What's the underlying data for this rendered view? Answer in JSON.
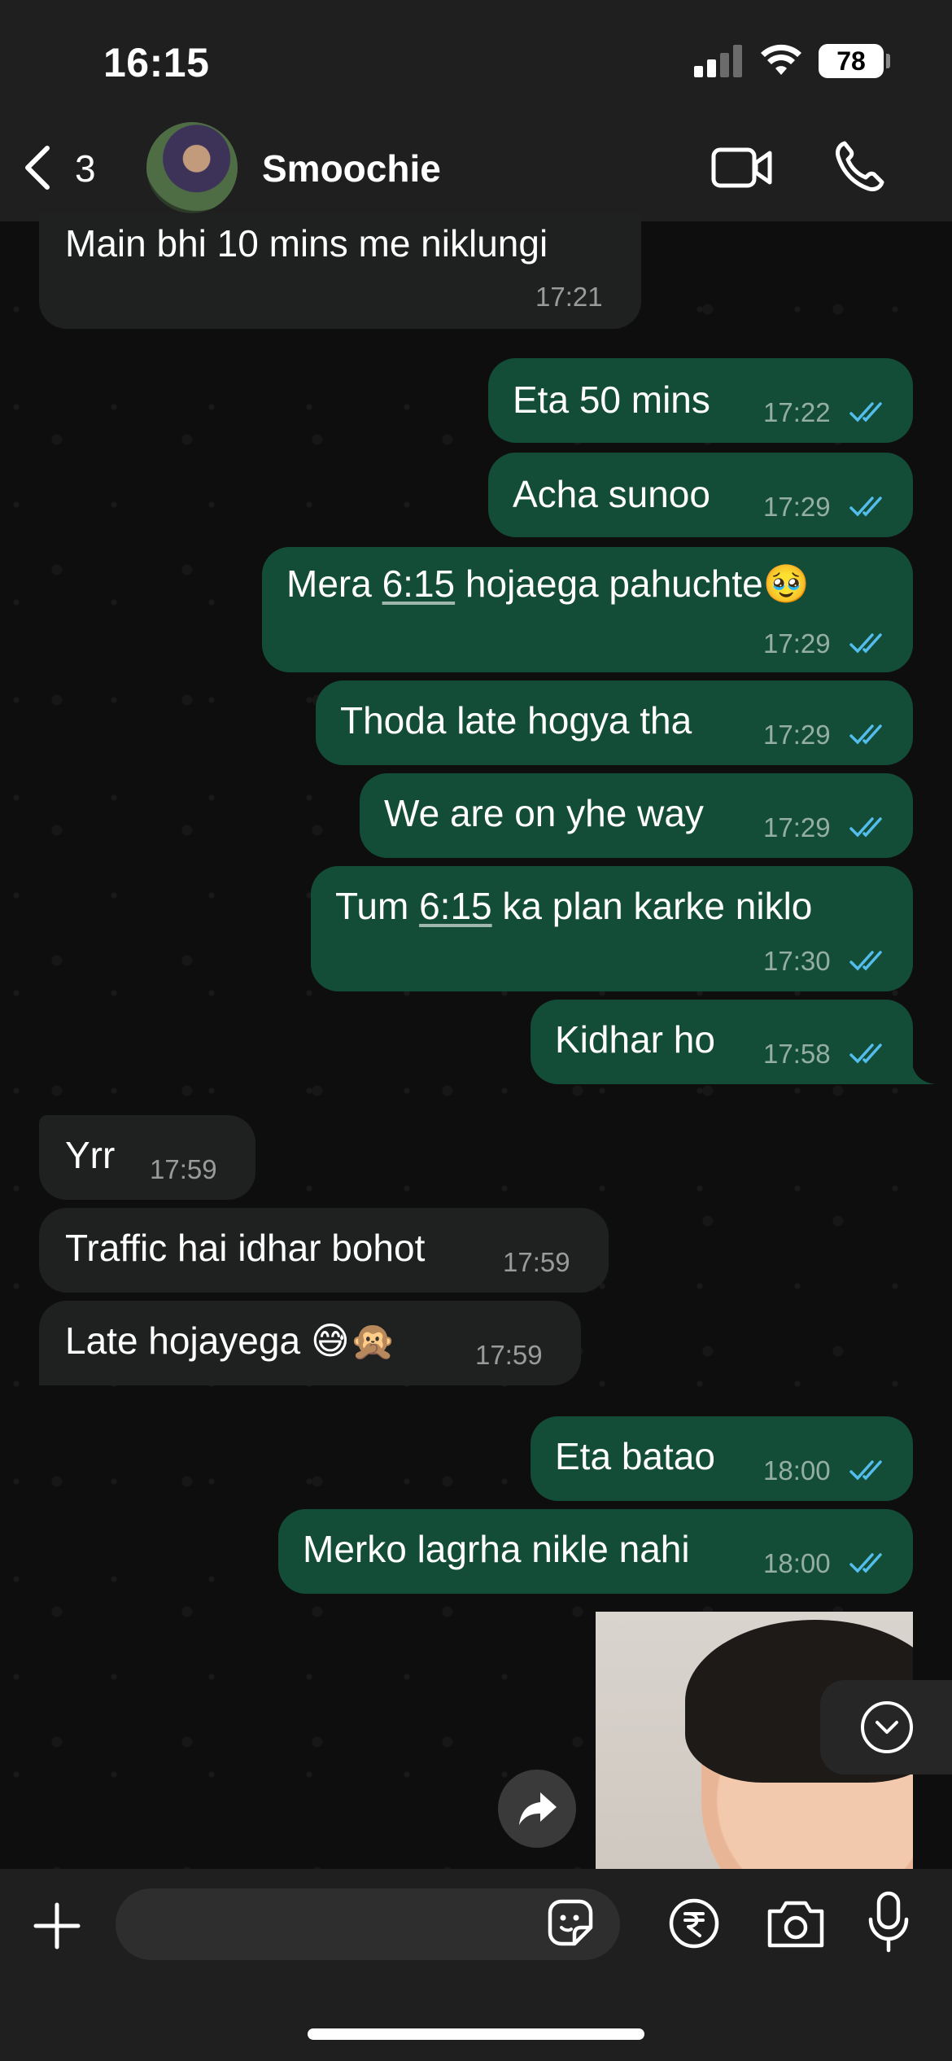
{
  "status_bar": {
    "time": "16:15",
    "battery": "78"
  },
  "header": {
    "back_count": "3",
    "contact_name": "Smoochie"
  },
  "messages": [
    {
      "text": "Main  bhi 10 mins me niklungi",
      "time": "17:21"
    },
    {
      "text": "Eta 50 mins",
      "time": "17:22"
    },
    {
      "text": "Acha sunoo",
      "time": "17:29"
    },
    {
      "text_a": "Mera ",
      "text_link": "6:15",
      "text_b": " hojaega pahuchte",
      "emoji": "🥹",
      "time": "17:29"
    },
    {
      "text": "Thoda late hogya tha",
      "time": "17:29"
    },
    {
      "text": "We are on yhe way",
      "time": "17:29"
    },
    {
      "text_a": "Tum ",
      "text_link": "6:15",
      "text_b": " ka plan karke niklo",
      "time": "17:30"
    },
    {
      "text": "Kidhar ho",
      "time": "17:58"
    },
    {
      "text": "Yrr",
      "time": "17:59"
    },
    {
      "text": "Traffic hai idhar bohot",
      "time": "17:59"
    },
    {
      "text": "Late hojayega ",
      "emoji": "😅🙊",
      "time": "17:59"
    },
    {
      "text": "Eta batao",
      "time": "18:00"
    },
    {
      "text": "Merko lagrha nikle nahi",
      "time": "18:00"
    }
  ],
  "composer": {
    "placeholder": ""
  },
  "colors": {
    "incoming": "#1f2121",
    "outgoing": "#134d37",
    "read_ticks": "#53bdeb"
  },
  "icons": [
    "back-chevron-icon",
    "video-call-icon",
    "phone-icon",
    "plus-icon",
    "sticker-icon",
    "rupee-icon",
    "camera-icon",
    "microphone-icon",
    "forward-icon",
    "chevron-down-icon",
    "read-ticks-icon"
  ]
}
